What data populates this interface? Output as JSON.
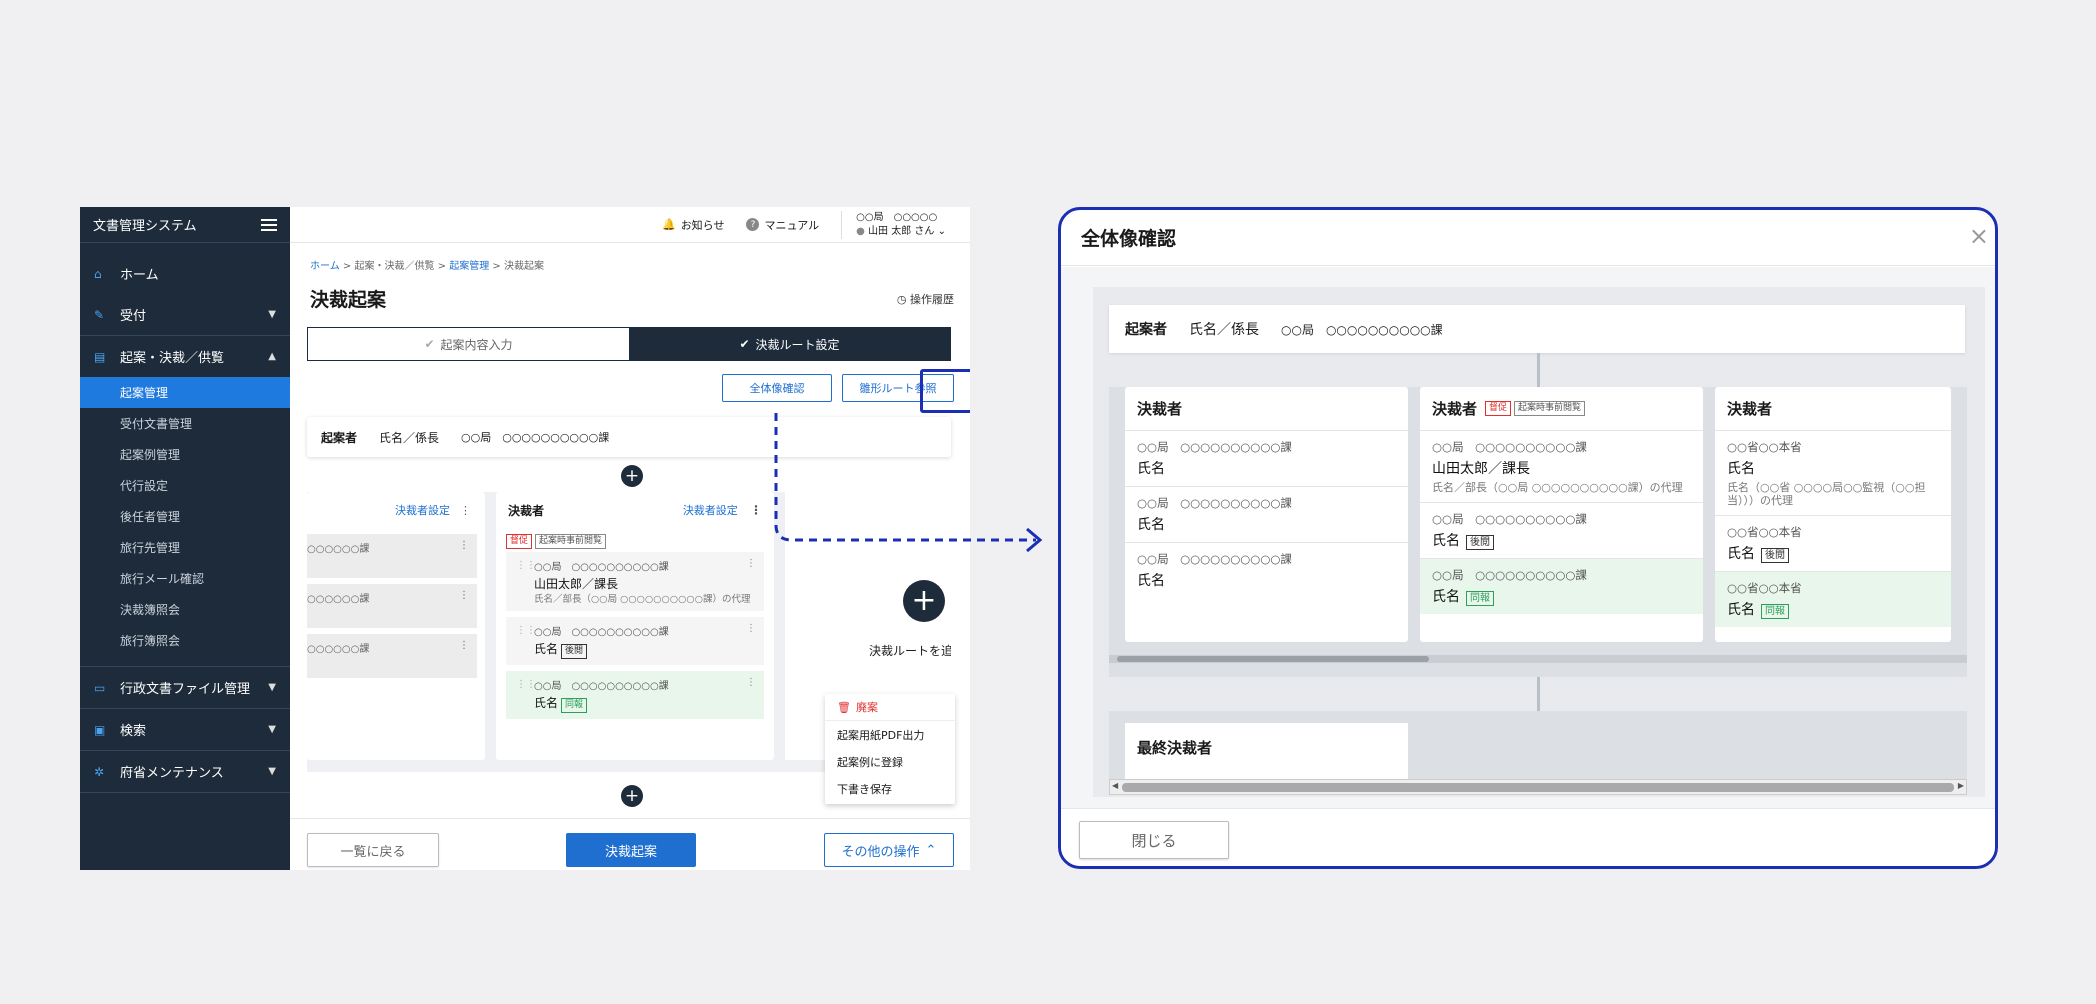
{
  "sidebar": {
    "title": "文書管理システム",
    "items": [
      {
        "icon": "home-icon",
        "label": "ホーム"
      },
      {
        "icon": "pin-icon",
        "label": "受付"
      },
      {
        "icon": "document-icon",
        "label": "起案・決裁／供覧"
      }
    ],
    "subitems": [
      "起案管理",
      "受付文書管理",
      "起案例管理",
      "代行設定",
      "後任者管理",
      "旅行先管理",
      "旅行メール確認",
      "決裁簿照会",
      "旅行簿照会"
    ],
    "bottom_items": [
      {
        "icon": "inbox-icon",
        "label": "行政文書ファイル管理"
      },
      {
        "icon": "search-doc-icon",
        "label": "検索"
      },
      {
        "icon": "gear-icon",
        "label": "府省メンテナンス"
      }
    ]
  },
  "topbar": {
    "notice": "お知らせ",
    "manual": "マニュアル",
    "org": "○○局　○○○○○",
    "user": "山田 太郎 さん"
  },
  "breadcrumb": {
    "home": "ホーム",
    "level2": "起案・決裁／供覧",
    "level3": "起案管理",
    "current": "決裁起案"
  },
  "page": {
    "title": "決裁起案",
    "history": "操作履歴",
    "step1": "起案内容入力",
    "step2": "決裁ルート設定",
    "overview_button": "全体像確認",
    "route_button": "雛形ルート参照"
  },
  "drafter": {
    "label": "起案者",
    "name": "氏名／係長",
    "org": "○○局　○○○○○○○○○○課"
  },
  "left_column": {
    "settings": "決裁者設定",
    "cards": [
      "○○○○○○課",
      "○○○○○○課",
      "○○○○○○課"
    ]
  },
  "mid_column": {
    "title": "決裁者",
    "settings": "決裁者設定",
    "tag_rush": "督促",
    "tag_prior": "起案時事前閲覧",
    "cards": [
      {
        "org": "○○局　○○○○○○○○○○課",
        "name": "山田太郎／課長",
        "note": "氏名／部長（○○局 ○○○○○○○○○○課）の代理",
        "tag": ""
      },
      {
        "org": "○○局　○○○○○○○○○○課",
        "name": "氏名",
        "note": "",
        "tag": "後閲"
      },
      {
        "org": "○○局　○○○○○○○○○○課",
        "name": "氏名",
        "note": "",
        "tag": "同報"
      }
    ]
  },
  "add_route_text": "決裁ルートを追",
  "menu": {
    "discard": "廃案",
    "pdf": "起案用紙PDF出力",
    "register": "起案例に登録",
    "draft": "下書き保存"
  },
  "footer": {
    "back": "一覧に戻る",
    "submit": "決裁起案",
    "other": "その他の操作"
  },
  "modal": {
    "title": "全体像確認",
    "close_label": "閉じる",
    "drafter_label": "起案者",
    "drafter_name": "氏名／係長",
    "drafter_org": "○○局　○○○○○○○○○○課",
    "columns": [
      {
        "title": "決裁者",
        "tags": [],
        "cards": [
          {
            "org": "○○局　○○○○○○○○○○課",
            "name": "氏名",
            "note": "",
            "tag": "",
            "green": false
          },
          {
            "org": "○○局　○○○○○○○○○○課",
            "name": "氏名",
            "note": "",
            "tag": "",
            "green": false
          },
          {
            "org": "○○局　○○○○○○○○○○課",
            "name": "氏名",
            "note": "",
            "tag": "",
            "green": false
          }
        ]
      },
      {
        "title": "決裁者",
        "tags": [
          "督促",
          "起案時事前閲覧"
        ],
        "cards": [
          {
            "org": "○○局　○○○○○○○○○○課",
            "name": "山田太郎／課長",
            "note": "氏名／部長（○○局 ○○○○○○○○○○課）の代理",
            "tag": "",
            "green": false
          },
          {
            "org": "○○局　○○○○○○○○○○課",
            "name": "氏名",
            "note": "",
            "tag": "後閲",
            "green": false
          },
          {
            "org": "○○局　○○○○○○○○○○課",
            "name": "氏名",
            "note": "",
            "tag": "同報",
            "green": true
          }
        ]
      },
      {
        "title": "決裁者",
        "tags": [],
        "cards": [
          {
            "org": "○○省○○本省",
            "name": "氏名",
            "note": "氏名（○○省 ○○○○局○○監視（○○担当）））の代理",
            "tag": "",
            "green": false
          },
          {
            "org": "○○省○○本省",
            "name": "氏名",
            "note": "",
            "tag": "後閲",
            "green": false
          },
          {
            "org": "○○省○○本省",
            "name": "氏名",
            "note": "",
            "tag": "同報",
            "green": true
          }
        ]
      }
    ],
    "final_title": "最終決裁者"
  },
  "colors": {
    "sidebar_bg": "#1d2b3a",
    "accent": "#1f6fd1",
    "highlight": "#1a2fb3"
  }
}
